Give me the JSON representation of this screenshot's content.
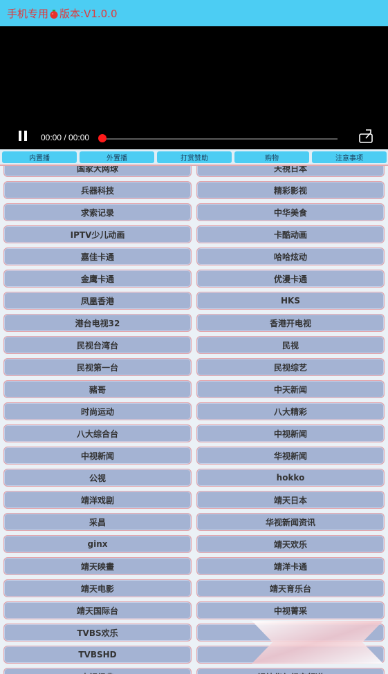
{
  "header": {
    "title_prefix": "手机专用",
    "title_suffix": "版本:V1.0.0",
    "logo_icon": "tomato-icon",
    "title_color": "#e0393b",
    "bar_color": "#4ccdf3"
  },
  "player": {
    "pause_icon": "pause-icon",
    "time": "00:00 / 00:00",
    "fullscreen_icon": "fullscreen-icon",
    "progress": 0,
    "thumb_color": "#ff1a1a"
  },
  "tabs": [
    {
      "label": "内置播"
    },
    {
      "label": "外置播"
    },
    {
      "label": "打赏赞助"
    },
    {
      "label": "购物"
    },
    {
      "label": "注意事项"
    }
  ],
  "channels": [
    [
      "国家大网球",
      "天視日本"
    ],
    [
      "兵器科技",
      "精彩影视"
    ],
    [
      "求索记录",
      "中华美食"
    ],
    [
      "IPTV少儿动画",
      "卡酷动画"
    ],
    [
      "嘉佳卡通",
      "哈哈炫动"
    ],
    [
      "金鹰卡通",
      "优漫卡通"
    ],
    [
      "凤凰香港",
      "HKS"
    ],
    [
      "港台电视32",
      "香港开电视"
    ],
    [
      "民视台湾台",
      "民视"
    ],
    [
      "民视第一台",
      "民视综艺"
    ],
    [
      "豬哥",
      "中天新闻"
    ],
    [
      "时尚运动",
      "八大精彩"
    ],
    [
      "八大综合台",
      "中视新闻"
    ],
    [
      "中视新闻",
      "华视新闻"
    ],
    [
      "公视",
      "hokko"
    ],
    [
      "靖洋戏剧",
      "靖天日本"
    ],
    [
      "采昌",
      "华视新闻资讯"
    ],
    [
      "ginx",
      "靖天欢乐"
    ],
    [
      "靖天映畫",
      "靖洋卡通"
    ],
    [
      "靖天电影",
      "靖天育乐台"
    ],
    [
      "靖天国际台",
      "中视菁采"
    ],
    [
      "TVBS欢乐",
      ""
    ],
    [
      "TVBSHD",
      ""
    ],
    [
      "中视经典",
      "视纳华仁纪实频道"
    ]
  ]
}
